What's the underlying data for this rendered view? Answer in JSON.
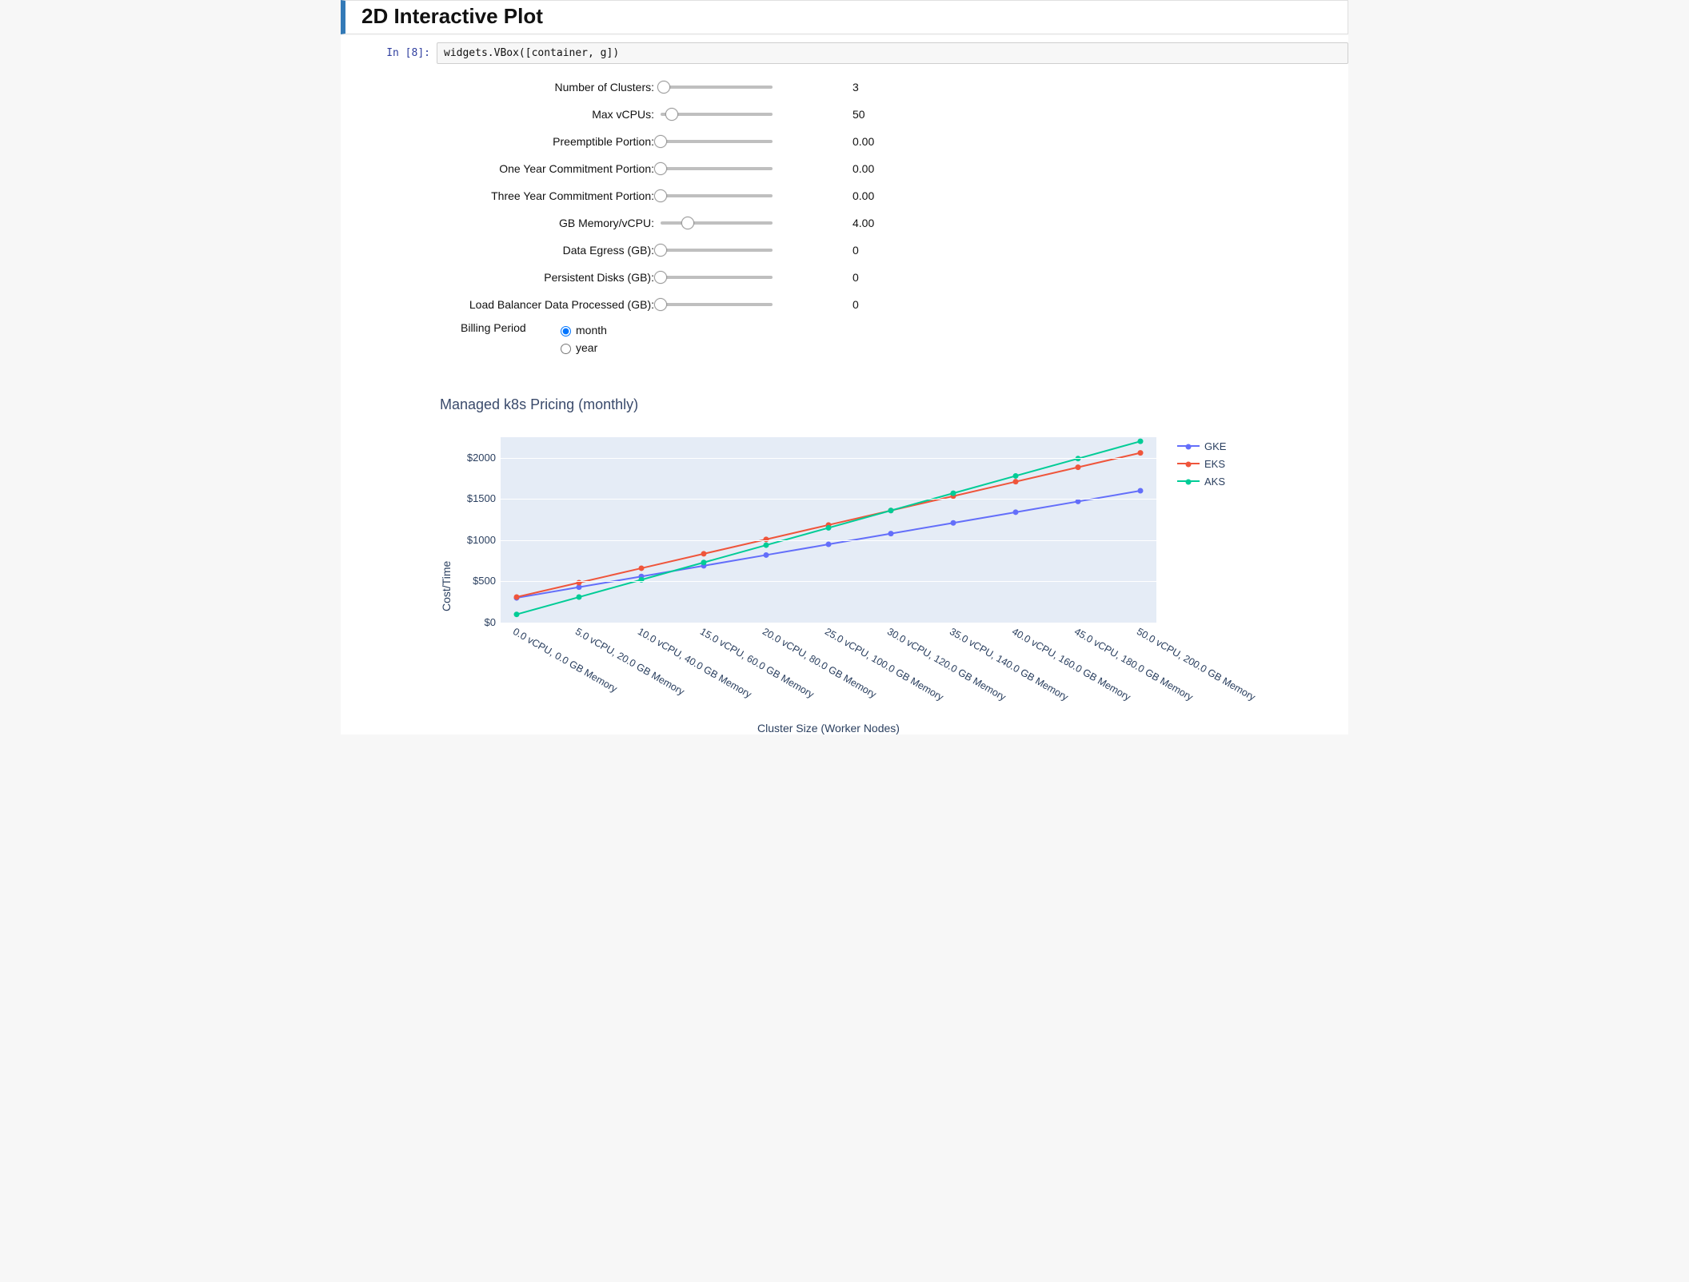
{
  "header": {
    "title": "2D Interactive Plot"
  },
  "code_cell": {
    "prompt": "In [8]:",
    "source": "widgets.VBox([container, g])"
  },
  "sliders": [
    {
      "label": "Number of Clusters:",
      "value_display": "3",
      "thumb_pct": 3
    },
    {
      "label": "Max vCPUs:",
      "value_display": "50",
      "thumb_pct": 10
    },
    {
      "label": "Preemptible Portion:",
      "value_display": "0.00",
      "thumb_pct": 0
    },
    {
      "label": "One Year Commitment Portion:",
      "value_display": "0.00",
      "thumb_pct": 0
    },
    {
      "label": "Three Year Commitment Portion:",
      "value_display": "0.00",
      "thumb_pct": 0
    },
    {
      "label": "GB Memory/vCPU:",
      "value_display": "4.00",
      "thumb_pct": 24
    },
    {
      "label": "Data Egress (GB):",
      "value_display": "0",
      "thumb_pct": 0
    },
    {
      "label": "Persistent Disks (GB):",
      "value_display": "0",
      "thumb_pct": 0
    },
    {
      "label": "Load Balancer Data Processed (GB):",
      "value_display": "0",
      "thumb_pct": 0
    }
  ],
  "radio": {
    "label": "Billing Period",
    "options": [
      "month",
      "year"
    ],
    "selected": "month"
  },
  "chart_data": {
    "type": "line",
    "title": "Managed k8s Pricing (monthly)",
    "xlabel": "Cluster Size (Worker Nodes)",
    "ylabel": "Cost/Time",
    "categories": [
      "0.0 vCPU, 0.0 GB Memory",
      "5.0 vCPU, 20.0 GB Memory",
      "10.0 vCPU, 40.0 GB Memory",
      "15.0 vCPU, 60.0 GB Memory",
      "20.0 vCPU, 80.0 GB Memory",
      "25.0 vCPU, 100.0 GB Memory",
      "30.0 vCPU, 120.0 GB Memory",
      "35.0 vCPU, 140.0 GB Memory",
      "40.0 vCPU, 160.0 GB Memory",
      "45.0 vCPU, 180.0 GB Memory",
      "50.0 vCPU, 200.0 GB Memory"
    ],
    "ytick_labels": [
      "$0",
      "$500",
      "$1000",
      "$1500",
      "$2000"
    ],
    "ylim": [
      0,
      2250
    ],
    "series": [
      {
        "name": "GKE",
        "color": "#636efa",
        "values": [
          300,
          430,
          560,
          690,
          820,
          950,
          1080,
          1210,
          1340,
          1470,
          1600
        ]
      },
      {
        "name": "EKS",
        "color": "#ef553b",
        "values": [
          310,
          485,
          660,
          835,
          1010,
          1185,
          1360,
          1535,
          1710,
          1885,
          2060
        ]
      },
      {
        "name": "AKS",
        "color": "#00cc96",
        "values": [
          100,
          310,
          520,
          730,
          940,
          1150,
          1360,
          1570,
          1780,
          1990,
          2200
        ]
      }
    ]
  }
}
